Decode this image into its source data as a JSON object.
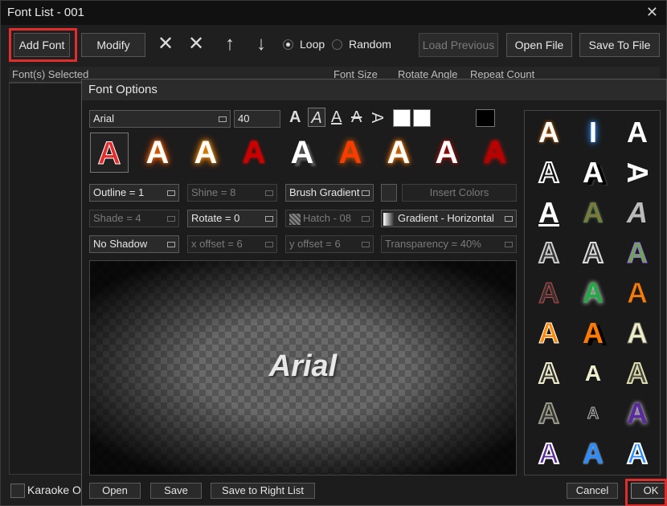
{
  "window": {
    "title": "Font List - 001",
    "close": "✕"
  },
  "toolbar": {
    "add_font": "Add Font",
    "modify": "Modify",
    "loop": "Loop",
    "random": "Random",
    "load_previous": "Load Previous",
    "open_file": "Open File",
    "save_to_file": "Save To File"
  },
  "list": {
    "columns": [
      "Font(s) Selected",
      "Font Size",
      "Rotate Angle",
      "Repeat Count"
    ]
  },
  "bottom": {
    "karaoke": "Karaoke Ov"
  },
  "dialog": {
    "title": "Font Options",
    "font_name": "Arial",
    "font_size": "40",
    "outline": "Outline = 1",
    "shine": "Shine = 8",
    "brush": "Brush Gradient",
    "insert_colors": "Insert Colors",
    "shade": "Shade = 4",
    "rotate": "Rotate = 0",
    "hatch": "Hatch - 08",
    "gradient": "Gradient - Horizontal",
    "shadow": "No Shadow",
    "x_offset": "x offset = 6",
    "y_offset": "y offset = 6",
    "transparency": "Transparency = 40%",
    "preview_text": "Arial",
    "sample_letter": "A",
    "btn_open": "Open",
    "btn_save": "Save",
    "btn_save_right": "Save to Right List",
    "btn_cancel": "Cancel",
    "btn_ok": "OK"
  },
  "colors": {
    "highlight": "#e52b2b",
    "accent_orange": "#ff7a00"
  }
}
